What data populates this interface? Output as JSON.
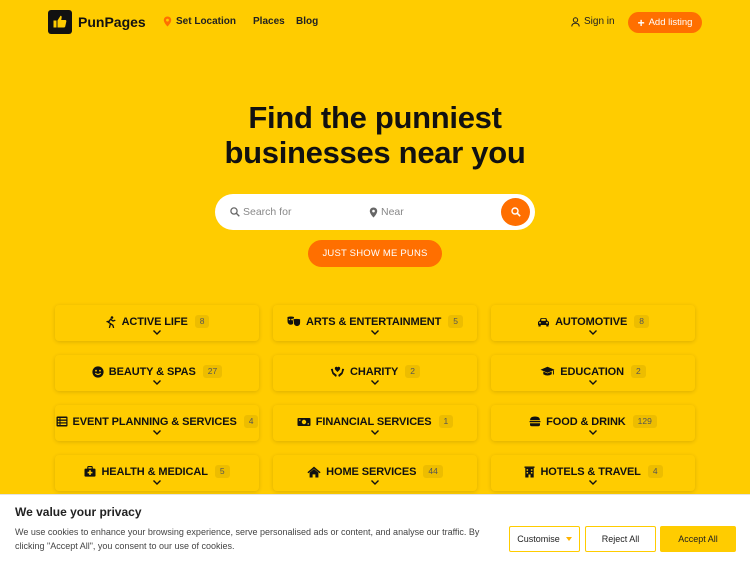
{
  "header": {
    "logo_text": "PunPages",
    "set_location": "Set Location",
    "nav": [
      "Places",
      "Blog"
    ],
    "sign_in": "Sign in",
    "add_listing": "Add listing"
  },
  "hero": {
    "title_line1": "Find the punniest",
    "title_line2": "businesses near you",
    "search_placeholder": "Search for",
    "near_placeholder": "Near",
    "puns_button": "JUST SHOW ME PUNS"
  },
  "categories": [
    {
      "label": "ACTIVE LIFE",
      "count": "8",
      "icon": "running-icon"
    },
    {
      "label": "ARTS & ENTERTAINMENT",
      "count": "5",
      "icon": "theater-masks-icon"
    },
    {
      "label": "AUTOMOTIVE",
      "count": "8",
      "icon": "car-icon"
    },
    {
      "label": "BEAUTY & SPAS",
      "count": "27",
      "icon": "smile-icon"
    },
    {
      "label": "CHARITY",
      "count": "2",
      "icon": "hands-heart-icon"
    },
    {
      "label": "EDUCATION",
      "count": "2",
      "icon": "graduation-cap-icon"
    },
    {
      "label": "EVENT PLANNING & SERVICES",
      "count": "4",
      "icon": "list-icon"
    },
    {
      "label": "FINANCIAL SERVICES",
      "count": "1",
      "icon": "money-icon"
    },
    {
      "label": "FOOD & DRINK",
      "count": "129",
      "icon": "burger-icon"
    },
    {
      "label": "HEALTH & MEDICAL",
      "count": "5",
      "icon": "medical-kit-icon"
    },
    {
      "label": "HOME SERVICES",
      "count": "44",
      "icon": "home-icon"
    },
    {
      "label": "HOTELS & TRAVEL",
      "count": "4",
      "icon": "hotel-icon"
    }
  ],
  "cookie": {
    "title": "We value your privacy",
    "text": "We use cookies to enhance your browsing experience, serve personalised ads or content, and analyse our traffic. By clicking \"Accept All\", you consent to our use of cookies.",
    "customise": "Customise",
    "reject": "Reject All",
    "accept": "Accept All"
  },
  "colors": {
    "background": "#FFCC00",
    "accent": "#FF6F00"
  }
}
